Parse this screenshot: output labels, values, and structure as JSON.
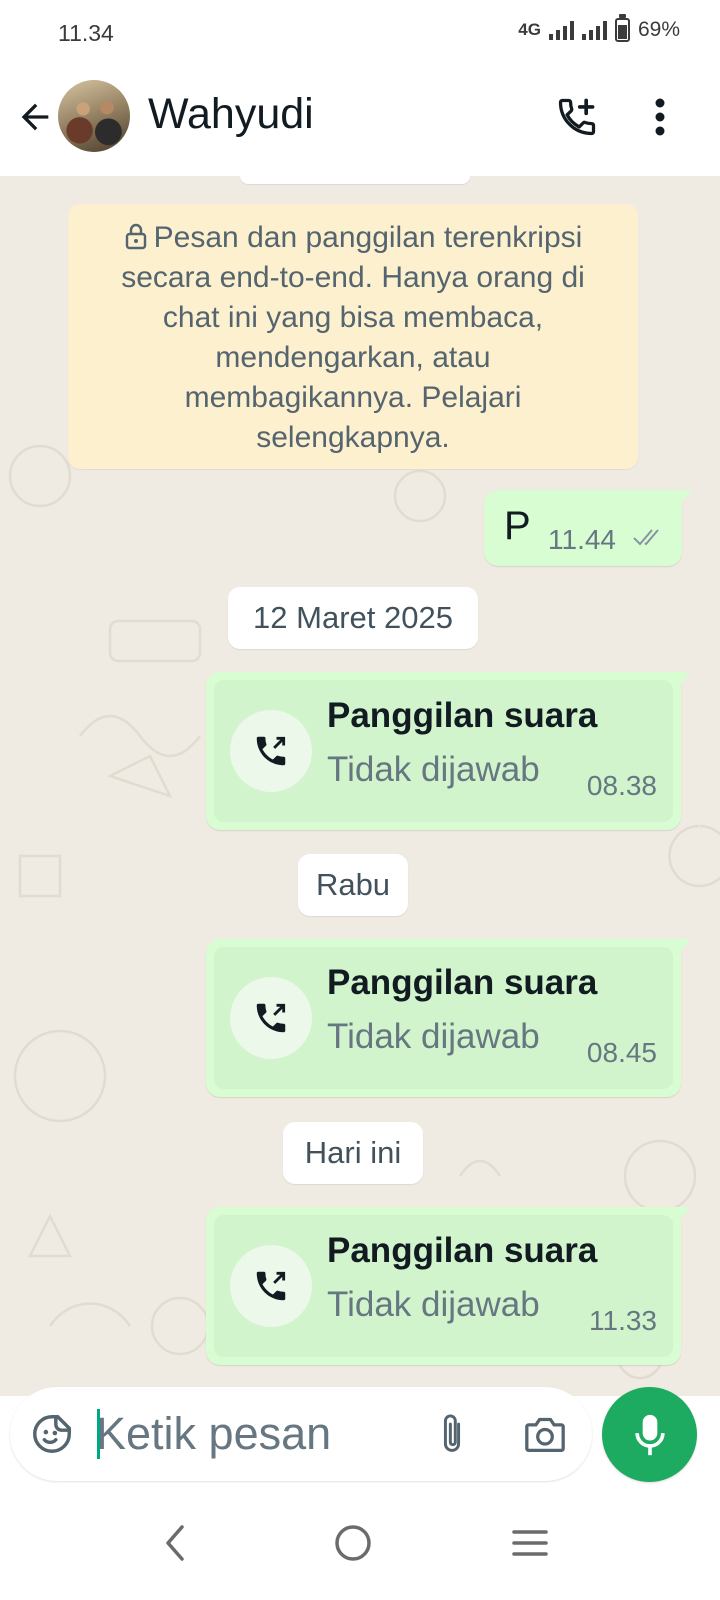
{
  "status_bar": {
    "time": "11.34",
    "network": "4G",
    "battery": "69%",
    "battery_level": 0.69
  },
  "header": {
    "contact_name": "Wahyudi",
    "icons": [
      "back-arrow-icon",
      "avatar",
      "add-call-icon",
      "more-vert-icon"
    ]
  },
  "chat": {
    "encryption_notice": "Pesan dan panggilan terenkripsi secara end-to-end. Hanya orang di chat ini yang bisa membaca, mendengarkan, atau membagikannya. Pelajari selengkapnya.",
    "messages": [
      {
        "type": "text",
        "text": "P",
        "time": "11.44",
        "status": "read"
      }
    ],
    "date_chips": [
      "12 Maret 2025",
      "Rabu",
      "Hari ini"
    ],
    "calls": [
      {
        "title": "Panggilan suara",
        "status": "Tidak dijawab",
        "time": "08.38"
      },
      {
        "title": "Panggilan suara",
        "status": "Tidak dijawab",
        "time": "08.45"
      },
      {
        "title": "Panggilan suara",
        "status": "Tidak dijawab",
        "time": "11.33"
      }
    ]
  },
  "composer": {
    "placeholder": "Ketik pesan",
    "value": ""
  },
  "colors": {
    "chat_bg": "#efeae2",
    "outgoing_bubble": "#d9fdd3",
    "notice_bg": "#fdf0cf",
    "accent_green": "#1daa61",
    "caret": "#00a884"
  }
}
